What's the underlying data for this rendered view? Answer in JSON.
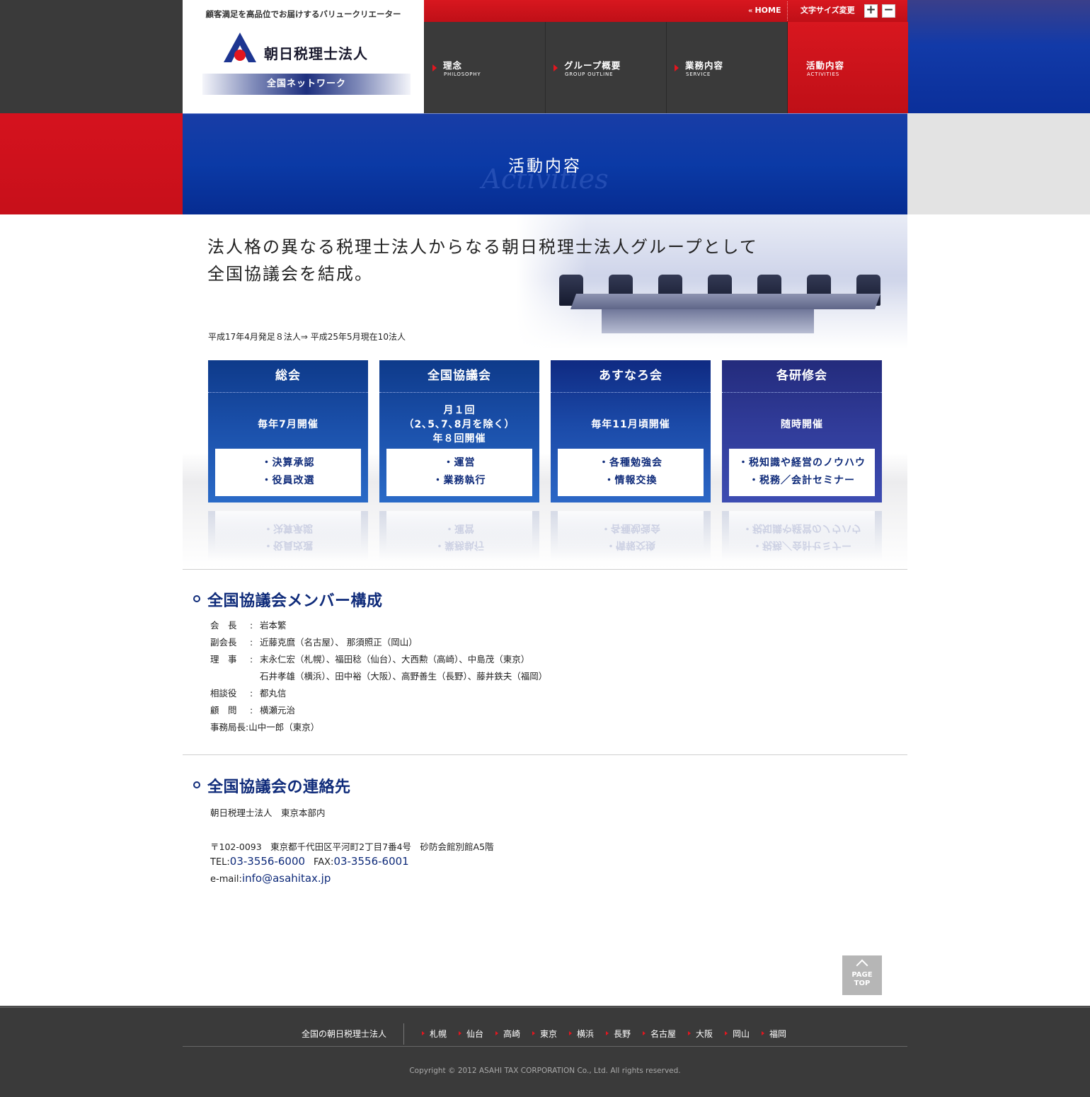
{
  "header": {
    "tagline": "顧客満足を高品位でお届けするバリュークリエーター",
    "logo_name": "朝日税理士法人",
    "network": "全国ネットワーク",
    "home_label": "HOME",
    "font_size_label": "文字サイズ変更",
    "font_plus": "+",
    "font_minus": "−"
  },
  "nav": [
    {
      "jp": "理念",
      "en": "PHILOSOPHY"
    },
    {
      "jp": "グループ概要",
      "en": "GROUP OUTLINE"
    },
    {
      "jp": "業務内容",
      "en": "SERVICE"
    },
    {
      "jp": "活動内容",
      "en": "ACTIVITIES"
    }
  ],
  "page_title": {
    "jp": "活動内容",
    "en": "Activities"
  },
  "intro": {
    "headline_1": "法人格の異なる税理士法人からなる朝日税理士法人グループとして",
    "headline_2": "全国協議会を結成。",
    "history": "平成17年4月発足８法人⇒ 平成25年5月現在10法人"
  },
  "blocks": [
    {
      "title": "総会",
      "schedule": "毎年7月開催",
      "items": [
        "・決算承認",
        "・役員改選"
      ]
    },
    {
      "title": "全国協議会",
      "schedule": "月１回\n（2､5､7､8月を除く）\n年８回開催",
      "items": [
        "・運営",
        "・業務執行"
      ]
    },
    {
      "title": "あすなろ会",
      "schedule": "毎年11月頃開催",
      "items": [
        "・各種勉強会",
        "・情報交換"
      ]
    },
    {
      "title": "各研修会",
      "schedule": "随時開催",
      "items": [
        "・税知識や経営のノウハウ",
        "・税務／会計セミナー"
      ]
    }
  ],
  "members": {
    "title": "全国協議会メンバー構成",
    "rows": [
      {
        "role": "会　長",
        "names": "岩本繁"
      },
      {
        "role": "副会長",
        "names": "近藤克麿（名古屋）、 那須照正（岡山）"
      },
      {
        "role": "理　事",
        "names": "末永仁宏（札幌）、福田稔（仙台）、大西勲（高崎）、中島茂（東京）"
      },
      {
        "role": "",
        "names": "石井孝雄（横浜）、田中裕（大阪）、高野善生（長野）、藤井鉄夫（福岡）"
      },
      {
        "role": "相談役",
        "names": "都丸信"
      },
      {
        "role": "顧　問",
        "names": "横瀬元治"
      },
      {
        "role": "事務局長",
        "names": "山中一郎（東京）"
      }
    ]
  },
  "contact": {
    "title": "全国協議会の連絡先",
    "org": "朝日税理士法人　東京本部内",
    "address": "〒102-0093　東京都千代田区平河町2丁目7番4号　砂防会館別館A5階",
    "tel_label": "TEL:",
    "tel": "03-3556-6000",
    "fax_label": "FAX:",
    "fax": "03-3556-6001",
    "email_label": "e-mail:",
    "email": "info@asahitax.jp"
  },
  "page_top": {
    "line1": "PAGE",
    "line2": "TOP"
  },
  "footer": {
    "label": "全国の朝日税理士法人",
    "cities": [
      "札幌",
      "仙台",
      "高崎",
      "東京",
      "横浜",
      "長野",
      "名古屋",
      "大阪",
      "岡山",
      "福岡"
    ],
    "copyright": "Copyright © 2012 ASAHI TAX CORPORATION Co., Ltd. All rights reserved."
  },
  "colors": {
    "brand_blue": "#0f2b7a",
    "brand_red": "#d8171f",
    "dark_gray": "#3a3a3a"
  }
}
